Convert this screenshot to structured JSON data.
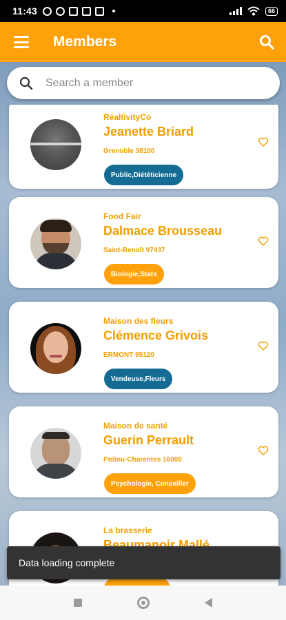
{
  "status_bar": {
    "time": "11:43",
    "battery": "66"
  },
  "app_bar": {
    "title": "Members"
  },
  "search": {
    "placeholder": "Search a member"
  },
  "colors": {
    "accent": "#ffa10a",
    "tag_blue": "#146c94",
    "tag_orange": "#ffa10a"
  },
  "members": [
    {
      "company": "RéaltivityCo",
      "name": "Jeanette Briard",
      "location": "Grenoble 38100",
      "tag": "Public,Diététicienne",
      "tag_color": "#146c94",
      "avatar": "avatar-1"
    },
    {
      "company": "Food Fair",
      "name": "Dalmace Brousseau",
      "location": "Saint-Benoît 97437",
      "tag": "Biologie,Stats",
      "tag_color": "#ffa10a",
      "avatar": "avatar-2"
    },
    {
      "company": "Maison des fleurs",
      "name": "Clémence Grivois",
      "location": "ERMONT 95120",
      "tag": "Vendeuse,Fleurs",
      "tag_color": "#146c94",
      "avatar": "avatar-3"
    },
    {
      "company": "Maison de santé",
      "name": "Guerin Perrault",
      "location": "Poitou-Charentes 16000",
      "tag": "Psychologie, Conseiller",
      "tag_color": "#ffa10a",
      "avatar": "avatar-4"
    },
    {
      "company": "La brasserie",
      "name": "Beaumanoir Mallé",
      "location": "",
      "tag": "",
      "tag_color": "#ffa10a",
      "avatar": "avatar-5"
    }
  ],
  "snackbar": {
    "message": "Data loading complete"
  },
  "icons": {
    "menu": "menu-icon",
    "search": "search-icon",
    "heart": "heart-outline-icon"
  }
}
